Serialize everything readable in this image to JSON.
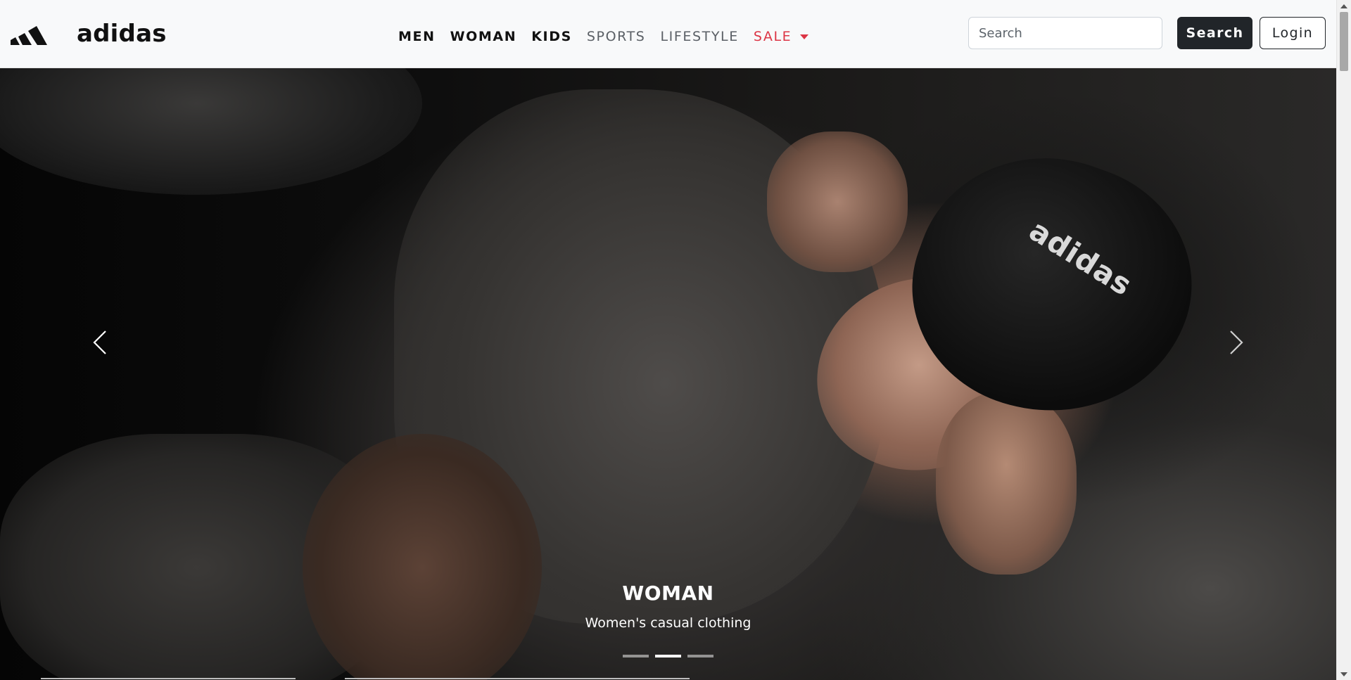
{
  "brand": {
    "name": "adidas",
    "logo_icon": "adidas-performance-logo"
  },
  "nav": {
    "items": [
      {
        "label": "MEN",
        "style": "strong"
      },
      {
        "label": "WOMAN",
        "style": "strong"
      },
      {
        "label": "KIDS",
        "style": "strong"
      },
      {
        "label": "SPORTS",
        "style": "muted"
      },
      {
        "label": "LIFESTYLE",
        "style": "muted"
      },
      {
        "label": "SALE",
        "style": "sale",
        "dropdown": true
      }
    ],
    "sale_color": "#dc3545"
  },
  "search": {
    "placeholder": "Search",
    "value": "",
    "button_label": "Search"
  },
  "login": {
    "label": "Login"
  },
  "carousel": {
    "slide_title": "WOMAN",
    "slide_subtitle": "Women's casual clothing",
    "cap_text": "adidas",
    "indicator_count": 3,
    "active_indicator": 1,
    "prev_icon": "chevron-left-icon",
    "next_icon": "chevron-right-icon"
  },
  "colors": {
    "navbar_bg": "#f8f9fa",
    "dark": "#212529"
  }
}
